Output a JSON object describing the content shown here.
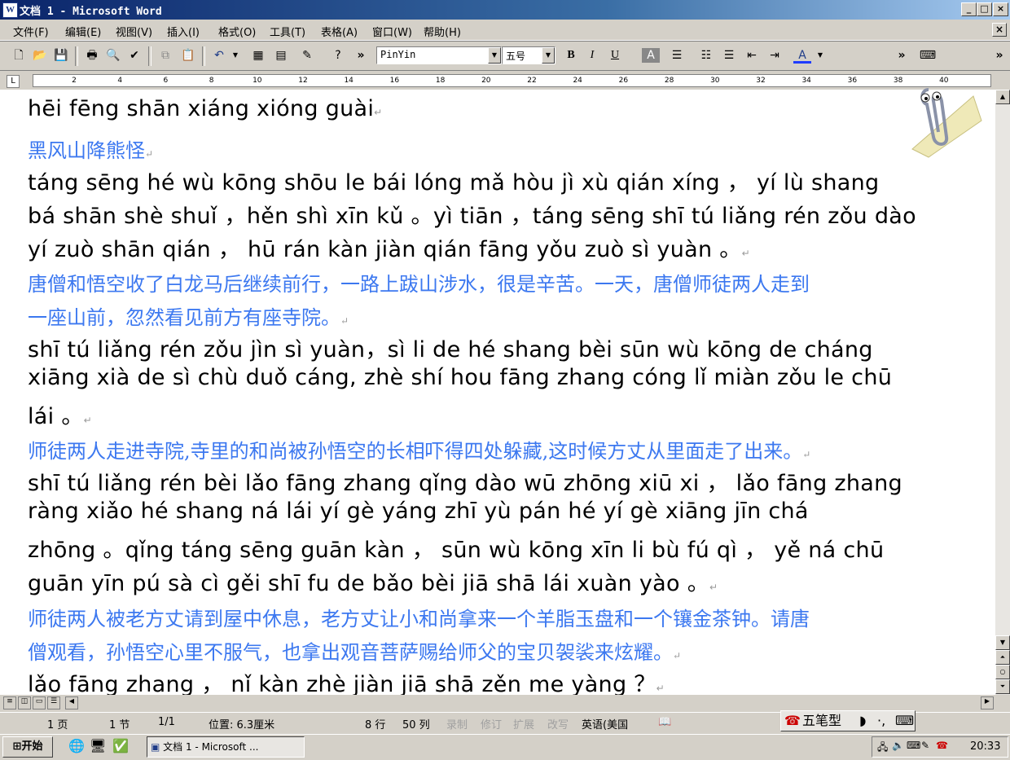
{
  "window": {
    "title": "文档 1 - Microsoft Word",
    "icon": "W",
    "controls": [
      "_",
      "□",
      "×"
    ]
  },
  "menu": {
    "items": [
      "文件(F)",
      "编辑(E)",
      "视图(V)",
      "插入(I)",
      "格式(O)",
      "工具(T)",
      "表格(A)",
      "窗口(W)",
      "帮助(H)"
    ],
    "close": "×"
  },
  "toolbar": {
    "font_name": "PinYin",
    "font_size": "五号",
    "bold": "B",
    "italic": "I",
    "underline": "U",
    "char_shading": "A",
    "font_color": "A",
    "overflow": "»"
  },
  "ruler": {
    "numbers": [
      "2",
      "4",
      "6",
      "8",
      "10",
      "12",
      "14",
      "16",
      "18",
      "20",
      "22",
      "24",
      "26",
      "28",
      "30",
      "32",
      "34",
      "36",
      "38",
      "40"
    ]
  },
  "document": {
    "lines": [
      {
        "kind": "py",
        "text": "hēi fēng shān xiáng xióng guài",
        "mark": "↵"
      },
      {
        "kind": "cn",
        "text": "黑风山降熊怪",
        "mark": "↵"
      },
      {
        "kind": "py",
        "text": "táng sēng hé wù kōng shōu le bái lóng mǎ hòu jì xù qián xíng ， yí lù shang",
        "mark": ""
      },
      {
        "kind": "py",
        "text": "bá shān shè shuǐ ，hěn shì xīn kǔ 。yì tiān ，táng sēng shī tú liǎng rén zǒu dào",
        "mark": ""
      },
      {
        "kind": "py",
        "text": "yí zuò shān qián ， hū rán kàn jiàn qián fāng yǒu zuò sì yuàn 。",
        "mark": "↵"
      },
      {
        "kind": "cn",
        "text": "唐僧和悟空收了白龙马后继续前行，一路上跋山涉水，很是辛苦。一天，唐僧师徒两人走到",
        "mark": ""
      },
      {
        "kind": "cn",
        "text": "一座山前，忽然看见前方有座寺院。",
        "mark": "↵"
      },
      {
        "kind": "py",
        "text": "shī tú liǎng rén zǒu jìn sì yuàn，sì  li de hé shang bèi sūn wù kōng de cháng",
        "mark": ""
      },
      {
        "kind": "py",
        "text": "xiāng xià de sì chù duǒ cáng, zhè shí hou fāng zhang cóng lǐ miàn zǒu le chū",
        "mark": ""
      },
      {
        "kind": "py",
        "text": "lái 。",
        "mark": "↵"
      },
      {
        "kind": "cn",
        "text": "师徒两人走进寺院,寺里的和尚被孙悟空的长相吓得四处躲藏,这时候方丈从里面走了出来。",
        "mark": "↵"
      },
      {
        "kind": "py",
        "text": "shī tú liǎng rén bèi lǎo fāng zhang qǐng dào wū zhōng xiū xi ， lǎo fāng zhang",
        "mark": ""
      },
      {
        "kind": "py",
        "text": "ràng xiǎo hé shang ná lái yí gè yáng zhī yù pán hé yí gè xiāng jīn chá",
        "mark": ""
      },
      {
        "kind": "py",
        "text": "zhōng 。qǐng táng sēng guān kàn ， sūn wù kōng xīn li bù fú qì ， yě ná chū",
        "mark": ""
      },
      {
        "kind": "py",
        "text": "guān yīn pú sà cì gěi shī fu de bǎo bèi jiā shā lái xuàn yào 。",
        "mark": "↵"
      },
      {
        "kind": "cn",
        "text": "师徒两人被老方丈请到屋中休息，老方丈让小和尚拿来一个羊脂玉盘和一个镶金茶钟。请唐",
        "mark": ""
      },
      {
        "kind": "cn",
        "text": "僧观看，孙悟空心里不服气，也拿出观音菩萨赐给师父的宝贝袈裟来炫耀。",
        "mark": "↵"
      },
      {
        "kind": "py",
        "text": "lǎo fāng zhang ， nǐ kàn zhè jiàn jiā shā zěn me yàng ？",
        "mark": "↵"
      }
    ]
  },
  "status": {
    "page": "1 页",
    "section": "1 节",
    "pages": "1/1",
    "position": "位置: 6.3厘米",
    "line": "8 行",
    "column": "50 列",
    "rec": "录制",
    "trk": "修订",
    "ext": "扩展",
    "ovr": "改写",
    "language": "英语(美国"
  },
  "ime": {
    "label": "五笔型"
  },
  "taskbar": {
    "start": "开始",
    "task": "文档 1 - Microsoft ...",
    "clock": "20:33"
  },
  "colors": {
    "pinyin": "#000000",
    "chinese": "#3c78f0",
    "titlebar": "#0a246a"
  }
}
